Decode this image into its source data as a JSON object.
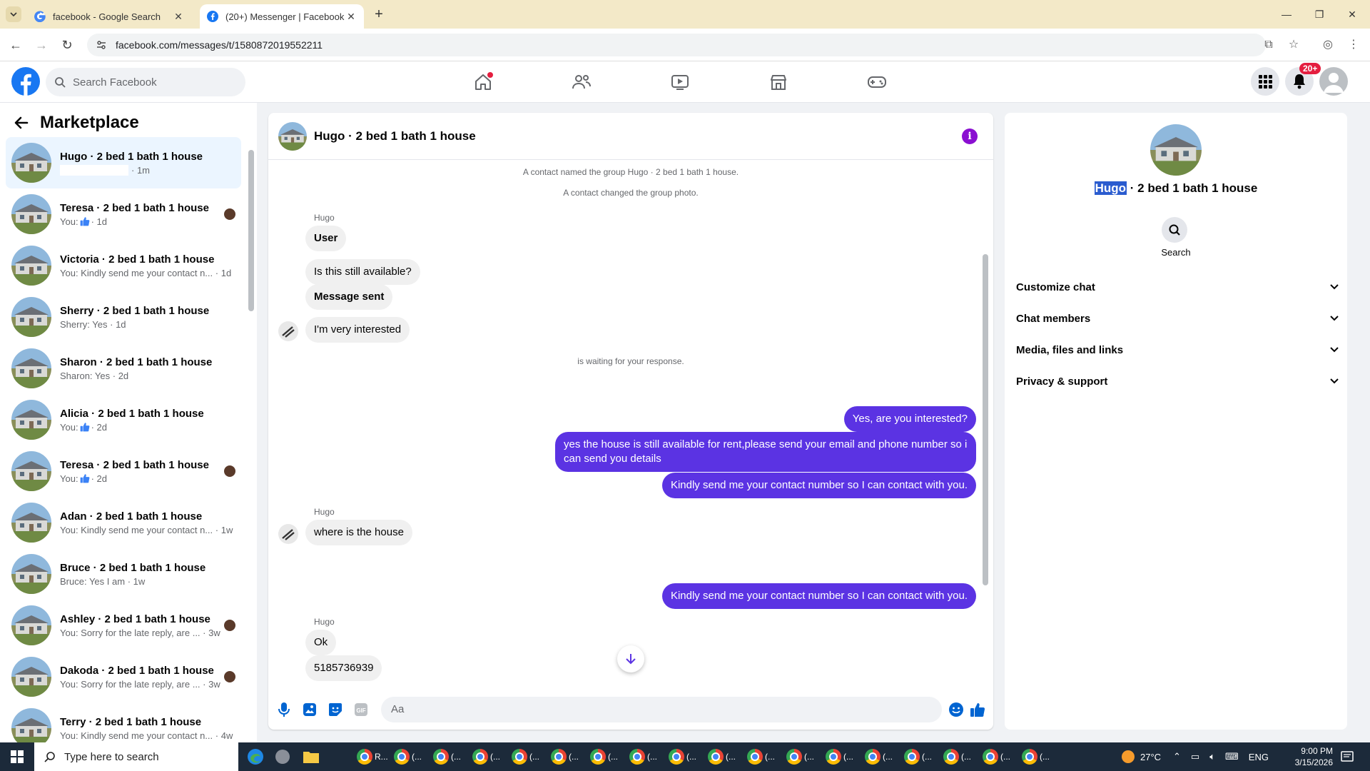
{
  "browser": {
    "tabs": [
      {
        "title": "facebook - Google Search",
        "active": false
      },
      {
        "title": "(20+) Messenger | Facebook",
        "active": true
      }
    ],
    "url": "facebook.com/messages/t/1580872019552211"
  },
  "fbnav": {
    "search_placeholder": "Search Facebook",
    "notif_badge": "20+",
    "accent": "#1877f2"
  },
  "left": {
    "title": "Marketplace",
    "conversations": [
      {
        "name": "Hugo · 2 bed 1 bath 1 house",
        "preview": "",
        "time": "· 1m",
        "selected": true,
        "seen_avatar": false
      },
      {
        "name": "Teresa · 2 bed 1 bath 1 house",
        "preview": "You:",
        "time": "· 1d",
        "like": true,
        "seen_avatar": true
      },
      {
        "name": "Victoria · 2 bed 1 bath 1 house",
        "preview": "You: Kindly send me your contact n...",
        "time": "· 1d",
        "seen_avatar": false
      },
      {
        "name": "Sherry · 2 bed 1 bath 1 house",
        "preview": "Sherry: Yes",
        "time": "· 1d",
        "seen_avatar": false
      },
      {
        "name": "Sharon · 2 bed 1 bath 1 house",
        "preview": "Sharon: Yes",
        "time": "· 2d",
        "seen_avatar": false
      },
      {
        "name": "Alicia · 2 bed 1 bath 1 house",
        "preview": "You:",
        "time": "· 2d",
        "like": true,
        "seen_avatar": false
      },
      {
        "name": "Teresa · 2 bed 1 bath 1 house",
        "preview": "You:",
        "time": "· 2d",
        "like": true,
        "seen_avatar": true
      },
      {
        "name": "Adan · 2 bed 1 bath 1 house",
        "preview": "You: Kindly send me your contact n...",
        "time": "· 1w",
        "seen_avatar": false
      },
      {
        "name": "Bruce · 2 bed 1 bath 1 house",
        "preview": "Bruce: Yes I am",
        "time": "· 1w",
        "seen_avatar": false
      },
      {
        "name": "Ashley · 2 bed 1 bath 1 house",
        "preview": "You: Sorry for the late reply, are ...",
        "time": "· 3w",
        "seen_avatar": true
      },
      {
        "name": "Dakoda · 2 bed 1 bath 1 house",
        "preview": "You: Sorry for the late reply, are ...",
        "time": "· 3w",
        "seen_avatar": true
      },
      {
        "name": "Terry · 2 bed 1 bath 1 house",
        "preview": "You: Kindly send me your contact n...",
        "time": "· 4w",
        "seen_avatar": false
      }
    ]
  },
  "chat": {
    "title": "Hugo · 2 bed 1 bath 1 house",
    "system1": "A contact named the group Hugo · 2 bed 1 bath 1 house.",
    "system2": "A contact changed the group photo.",
    "sender1": "Hugo",
    "msg_user": "User",
    "msg_available": "Is this still available?",
    "msg_sent": "Message sent",
    "msg_interested": "I'm very interested",
    "waiting": "is waiting for your response.",
    "out1": "Yes, are you interested?",
    "out2": "yes the house is still available for rent,please send your email and phone number so i can send you details",
    "out3": "Kindly send me your contact number so I can contact with you.",
    "sender2": "Hugo",
    "msg_where": "where is the house",
    "out4": "Kindly send me your contact number so I can contact with you.",
    "sender3": "Hugo",
    "msg_ok": "Ok",
    "msg_phone": "5185736939",
    "composer_placeholder": "Aa",
    "bubble_color": "#5b33e3"
  },
  "right": {
    "name_highlight": "Hugo",
    "name_rest": " · 2 bed 1 bath 1 house",
    "search_label": "Search",
    "sections": [
      "Customize chat",
      "Chat members",
      "Media, files and links",
      "Privacy & support"
    ]
  },
  "taskbar": {
    "search_placeholder": "Type here to search",
    "temp": "27°C",
    "lang": "ENG",
    "time": "9:00 PM",
    "date": "3/15/2026",
    "app_labels": [
      "R...",
      "(...",
      "(...",
      "(...",
      "(...",
      "(...",
      "(...",
      "(...",
      "(...",
      "(...",
      "(...",
      "(...",
      "(...",
      "(...",
      "(...",
      "(...",
      "(...",
      "(..."
    ]
  }
}
